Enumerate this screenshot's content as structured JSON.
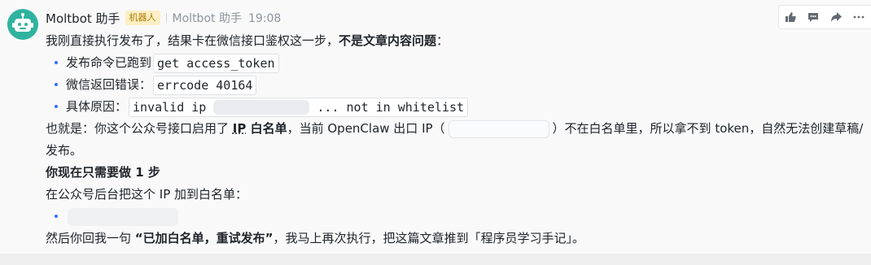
{
  "message": {
    "sender": "Moltbot 助手",
    "tag": "机器人",
    "meta_name": "Moltbot 助手",
    "time": "19:08"
  },
  "actions": [
    "like-icon",
    "reply-icon",
    "forward-icon",
    "more-icon"
  ],
  "content": {
    "intro_a": "我刚直接执行发布了，结果卡在微信接口鉴权这一步，",
    "intro_b": "不是文章内容问题",
    "intro_c": "：",
    "bullet1_label": "发布命令已跑到",
    "bullet1_code": "get access_token",
    "bullet2_label": "微信返回错误：",
    "bullet2_code": "errcode 40164",
    "bullet3_label": "具体原因：",
    "bullet3_code_a": "invalid ip",
    "bullet3_code_b": "... not in whitelist",
    "explain_a": "也就是：你这个公众号接口启用了 ",
    "explain_b": "IP",
    "explain_c": " 白名单",
    "explain_d": "，当前 OpenClaw 出口 IP（",
    "explain_e": "）不在白名单里，所以拿不到 token，自然无法创建草稿/发布。",
    "step_heading": "你现在只需要做 1 步",
    "step_text": "在公众号后台把这个 IP 加到白名单：",
    "reply_a": "然后你回我一句 ",
    "reply_b": "“已加白名单，重试发布”",
    "reply_c": "，我马上再次执行，把这篇文章推到「程序员学习手记」。"
  }
}
